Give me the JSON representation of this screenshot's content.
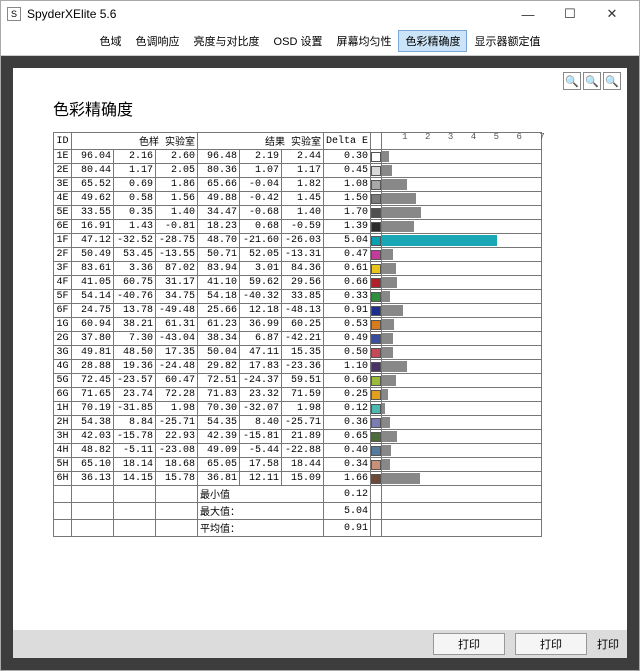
{
  "window": {
    "title": "SpyderXElite 5.6"
  },
  "tabs": [
    {
      "label": "色域",
      "active": false
    },
    {
      "label": "色调响应",
      "active": false
    },
    {
      "label": "亮度与对比度",
      "active": false
    },
    {
      "label": "OSD 设置",
      "active": false
    },
    {
      "label": "屏幕均匀性",
      "active": false
    },
    {
      "label": "色彩精确度",
      "active": true
    },
    {
      "label": "显示器额定值",
      "active": false
    }
  ],
  "report": {
    "title": "色彩精确度",
    "headers": {
      "id": "ID",
      "sample": "色样 实验室",
      "result": "结果 实验室",
      "delta": "Delta E"
    },
    "axis_max": 7,
    "rows": [
      {
        "id": "1E",
        "s": [
          96.04,
          2.16,
          2.6
        ],
        "r": [
          96.48,
          2.19,
          2.44
        ],
        "de": 0.3,
        "color": "#ffffff",
        "bar": "#888"
      },
      {
        "id": "2E",
        "s": [
          80.44,
          1.17,
          2.05
        ],
        "r": [
          80.36,
          1.07,
          1.17
        ],
        "de": 0.45,
        "color": "#d8d8d8",
        "bar": "#888"
      },
      {
        "id": "3E",
        "s": [
          65.52,
          0.69,
          1.86
        ],
        "r": [
          65.66,
          -0.04,
          1.82
        ],
        "de": 1.08,
        "color": "#a8a8a8",
        "bar": "#888"
      },
      {
        "id": "4E",
        "s": [
          49.62,
          0.58,
          1.56
        ],
        "r": [
          49.88,
          -0.42,
          1.45
        ],
        "de": 1.5,
        "color": "#7a7a7a",
        "bar": "#888"
      },
      {
        "id": "5E",
        "s": [
          33.55,
          0.35,
          1.4
        ],
        "r": [
          34.47,
          -0.68,
          1.4
        ],
        "de": 1.7,
        "color": "#505050",
        "bar": "#888"
      },
      {
        "id": "6E",
        "s": [
          16.91,
          1.43,
          -0.81
        ],
        "r": [
          18.23,
          0.68,
          -0.59
        ],
        "de": 1.39,
        "color": "#2b2b2b",
        "bar": "#888"
      },
      {
        "id": "1F",
        "s": [
          47.12,
          -32.52,
          -28.75
        ],
        "r": [
          48.7,
          -21.6,
          -26.03
        ],
        "de": 5.04,
        "color": "#0aa0af",
        "bar": "#1aa7b5"
      },
      {
        "id": "2F",
        "s": [
          50.49,
          53.45,
          -13.55
        ],
        "r": [
          50.71,
          52.05,
          -13.31
        ],
        "de": 0.47,
        "color": "#c23a9a",
        "bar": "#888"
      },
      {
        "id": "3F",
        "s": [
          83.61,
          3.36,
          87.02
        ],
        "r": [
          83.94,
          3.01,
          84.36
        ],
        "de": 0.61,
        "color": "#e9c61b",
        "bar": "#888"
      },
      {
        "id": "4F",
        "s": [
          41.05,
          60.75,
          31.17
        ],
        "r": [
          41.1,
          59.62,
          29.56
        ],
        "de": 0.66,
        "color": "#b0202a",
        "bar": "#888"
      },
      {
        "id": "5F",
        "s": [
          54.14,
          -40.76,
          34.75
        ],
        "r": [
          54.18,
          -40.32,
          33.85
        ],
        "de": 0.33,
        "color": "#2f8f3f",
        "bar": "#888"
      },
      {
        "id": "6F",
        "s": [
          24.75,
          13.78,
          -49.48
        ],
        "r": [
          25.66,
          12.18,
          -48.13
        ],
        "de": 0.91,
        "color": "#1c2e8d",
        "bar": "#888"
      },
      {
        "id": "1G",
        "s": [
          60.94,
          38.21,
          61.31
        ],
        "r": [
          61.23,
          36.99,
          60.25
        ],
        "de": 0.53,
        "color": "#d77b1c",
        "bar": "#888"
      },
      {
        "id": "2G",
        "s": [
          37.8,
          7.3,
          -43.04
        ],
        "r": [
          38.34,
          6.87,
          -42.21
        ],
        "de": 0.49,
        "color": "#3a4ea0",
        "bar": "#888"
      },
      {
        "id": "3G",
        "s": [
          49.81,
          48.5,
          17.35
        ],
        "r": [
          50.04,
          47.11,
          15.35
        ],
        "de": 0.5,
        "color": "#c44a58",
        "bar": "#888"
      },
      {
        "id": "4G",
        "s": [
          28.88,
          19.36,
          -24.48
        ],
        "r": [
          29.82,
          17.83,
          -23.36
        ],
        "de": 1.1,
        "color": "#4a3466",
        "bar": "#888"
      },
      {
        "id": "5G",
        "s": [
          72.45,
          -23.57,
          60.47
        ],
        "r": [
          72.51,
          -24.37,
          59.51
        ],
        "de": 0.6,
        "color": "#9cbb3a",
        "bar": "#888"
      },
      {
        "id": "6G",
        "s": [
          71.65,
          23.74,
          72.28
        ],
        "r": [
          71.83,
          23.32,
          71.59
        ],
        "de": 0.25,
        "color": "#e2a01f",
        "bar": "#888"
      },
      {
        "id": "1H",
        "s": [
          70.19,
          -31.85,
          1.98
        ],
        "r": [
          70.3,
          -32.07,
          1.98
        ],
        "de": 0.12,
        "color": "#4dbab0",
        "bar": "#888"
      },
      {
        "id": "2H",
        "s": [
          54.38,
          8.84,
          -25.71
        ],
        "r": [
          54.35,
          8.4,
          -25.71
        ],
        "de": 0.36,
        "color": "#7b7db0",
        "bar": "#888"
      },
      {
        "id": "3H",
        "s": [
          42.03,
          -15.78,
          22.93
        ],
        "r": [
          42.39,
          -15.81,
          21.89
        ],
        "de": 0.65,
        "color": "#4d6a3a",
        "bar": "#888"
      },
      {
        "id": "4H",
        "s": [
          48.82,
          -5.11,
          -23.08
        ],
        "r": [
          49.09,
          -5.44,
          -22.88
        ],
        "de": 0.4,
        "color": "#567a9c",
        "bar": "#888"
      },
      {
        "id": "5H",
        "s": [
          65.1,
          18.14,
          18.68
        ],
        "r": [
          65.05,
          17.58,
          18.44
        ],
        "de": 0.34,
        "color": "#c89078",
        "bar": "#888"
      },
      {
        "id": "6H",
        "s": [
          36.13,
          14.15,
          15.78
        ],
        "r": [
          36.81,
          12.11,
          15.09
        ],
        "de": 1.66,
        "color": "#6d4a36",
        "bar": "#888"
      }
    ],
    "summary": [
      {
        "label": "最小值",
        "value": 0.12
      },
      {
        "label": "最大值：",
        "value": 5.04
      },
      {
        "label": "平均值：",
        "value": 0.91
      }
    ]
  },
  "footer": {
    "btn1": "打印",
    "btn2": "打印",
    "txt": "打印"
  },
  "chart_data": {
    "type": "bar",
    "title": "色彩精确度 Delta E",
    "xlabel": "Delta E",
    "ylabel": "ID",
    "xlim": [
      0,
      7
    ],
    "categories": [
      "1E",
      "2E",
      "3E",
      "4E",
      "5E",
      "6E",
      "1F",
      "2F",
      "3F",
      "4F",
      "5F",
      "6F",
      "1G",
      "2G",
      "3G",
      "4G",
      "5G",
      "6G",
      "1H",
      "2H",
      "3H",
      "4H",
      "5H",
      "6H"
    ],
    "values": [
      0.3,
      0.45,
      1.08,
      1.5,
      1.7,
      1.39,
      5.04,
      0.47,
      0.61,
      0.66,
      0.33,
      0.91,
      0.53,
      0.49,
      0.5,
      1.1,
      0.6,
      0.25,
      0.12,
      0.36,
      0.65,
      0.4,
      0.34,
      1.66
    ]
  }
}
